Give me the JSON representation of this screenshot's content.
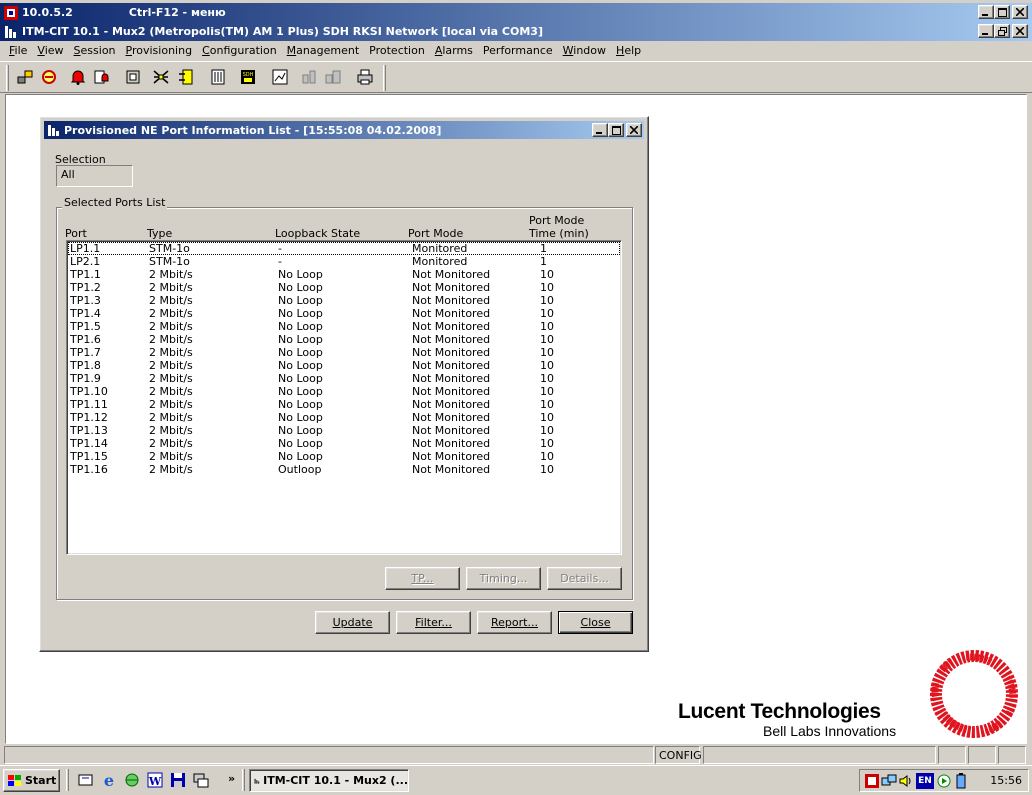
{
  "outer_title": {
    "text": "10.0.5.2",
    "hint": "Ctrl-F12 - меню"
  },
  "app_title": {
    "text": "ITM-CIT 10.1 - Mux2 (Metropolis(TM) AM 1 Plus) SDH RKSI Network [local via COM3]"
  },
  "menu": [
    {
      "label": "File",
      "key": "F",
      "rest": "ile"
    },
    {
      "label": "View",
      "key": "V",
      "rest": "iew"
    },
    {
      "label": "Session",
      "key": "S",
      "rest": "ession"
    },
    {
      "label": "Provisioning",
      "key": "P",
      "rest": "rovisioning"
    },
    {
      "label": "Configuration",
      "key": "C",
      "rest": "onfiguration"
    },
    {
      "label": "Management",
      "key": "M",
      "rest": "anagement"
    },
    {
      "label": "Protection",
      "key": "",
      "rest": "Protection"
    },
    {
      "label": "Alarms",
      "key": "A",
      "rest": "larms"
    },
    {
      "label": "Performance",
      "key": "",
      "rest": "Performance"
    },
    {
      "label": "Window",
      "key": "W",
      "rest": "indow"
    },
    {
      "label": "Help",
      "key": "H",
      "rest": "elp"
    }
  ],
  "toolbar_icons": [
    "network-icon",
    "session-icon",
    "alarm-bell-icon",
    "alarm-list-icon",
    "ne-icon",
    "cross-connect-icon",
    "port-icon",
    "equipment-icon",
    "sdh-icon",
    "performance-icon",
    "disabled-icon-1",
    "disabled-icon-2",
    "print-icon"
  ],
  "dialog": {
    "title": "Provisioned NE Port Information List - [15:55:08 04.02.2008]",
    "selection_label": "Selection",
    "selection_value": "All",
    "group_label": "Selected Ports List",
    "columns": {
      "port": "Port",
      "type": "Type",
      "loopback": "Loopback State",
      "mode": "Port Mode",
      "time_line1": "Port Mode",
      "time_line2": "Time (min)"
    },
    "rows": [
      {
        "port": "LP1.1",
        "type": "STM-1o",
        "loop": "-",
        "mode": "Monitored",
        "time": "1"
      },
      {
        "port": "LP2.1",
        "type": "STM-1o",
        "loop": "-",
        "mode": "Monitored",
        "time": "1"
      },
      {
        "port": "TP1.1",
        "type": "2 Mbit/s",
        "loop": "No Loop",
        "mode": "Not Monitored",
        "time": "10"
      },
      {
        "port": "TP1.2",
        "type": "2 Mbit/s",
        "loop": "No Loop",
        "mode": "Not Monitored",
        "time": "10"
      },
      {
        "port": "TP1.3",
        "type": "2 Mbit/s",
        "loop": "No Loop",
        "mode": "Not Monitored",
        "time": "10"
      },
      {
        "port": "TP1.4",
        "type": "2 Mbit/s",
        "loop": "No Loop",
        "mode": "Not Monitored",
        "time": "10"
      },
      {
        "port": "TP1.5",
        "type": "2 Mbit/s",
        "loop": "No Loop",
        "mode": "Not Monitored",
        "time": "10"
      },
      {
        "port": "TP1.6",
        "type": "2 Mbit/s",
        "loop": "No Loop",
        "mode": "Not Monitored",
        "time": "10"
      },
      {
        "port": "TP1.7",
        "type": "2 Mbit/s",
        "loop": "No Loop",
        "mode": "Not Monitored",
        "time": "10"
      },
      {
        "port": "TP1.8",
        "type": "2 Mbit/s",
        "loop": "No Loop",
        "mode": "Not Monitored",
        "time": "10"
      },
      {
        "port": "TP1.9",
        "type": "2 Mbit/s",
        "loop": "No Loop",
        "mode": "Not Monitored",
        "time": "10"
      },
      {
        "port": "TP1.10",
        "type": "2 Mbit/s",
        "loop": "No Loop",
        "mode": "Not Monitored",
        "time": "10"
      },
      {
        "port": "TP1.11",
        "type": "2 Mbit/s",
        "loop": "No Loop",
        "mode": "Not Monitored",
        "time": "10"
      },
      {
        "port": "TP1.12",
        "type": "2 Mbit/s",
        "loop": "No Loop",
        "mode": "Not Monitored",
        "time": "10"
      },
      {
        "port": "TP1.13",
        "type": "2 Mbit/s",
        "loop": "No Loop",
        "mode": "Not Monitored",
        "time": "10"
      },
      {
        "port": "TP1.14",
        "type": "2 Mbit/s",
        "loop": "No Loop",
        "mode": "Not Monitored",
        "time": "10"
      },
      {
        "port": "TP1.15",
        "type": "2 Mbit/s",
        "loop": "No Loop",
        "mode": "Not Monitored",
        "time": "10"
      },
      {
        "port": "TP1.16",
        "type": "2 Mbit/s",
        "loop": "Outloop",
        "mode": "Not Monitored",
        "time": "10"
      }
    ],
    "buttons": {
      "tp": "TP...",
      "timing": "Timing...",
      "details": "Details...",
      "update": "Update",
      "filter": "Filter...",
      "report": "Report...",
      "close": "Close"
    }
  },
  "logo": {
    "name": "Lucent Technologies",
    "tagline": "Bell Labs Innovations",
    "color": "#e0141e"
  },
  "status": {
    "mode": "CONFIG"
  },
  "taskbar": {
    "start": "Start",
    "chevron": "»",
    "task": "ITM-CIT 10.1 - Mux2 (...",
    "lang": "EN",
    "clock": "15:56"
  },
  "colors": {
    "title_start": "#0a246a",
    "title_end": "#a6caf0",
    "face": "#d4d0c8"
  }
}
